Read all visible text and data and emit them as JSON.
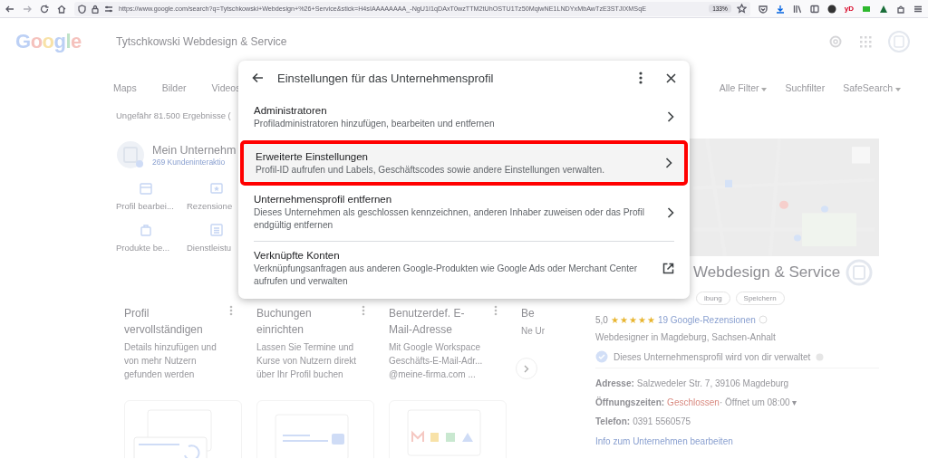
{
  "browser": {
    "url": "https://www.google.com/search?q=Tytschkowski+Webdesign+%26+Service&stick=H4sIAAAAAAAA_-NgU1I1qDAxT0wzTTM2tUhOSTU1Tz50MqiwNE1LNDYxMbAwTzE3STJIXMSqE",
    "zoom": "133%",
    "extension_label": "yD"
  },
  "page": {
    "logo": "Google",
    "query": "Tytschkowski Webdesign & Service",
    "tabs": [
      {
        "label": "Maps"
      },
      {
        "label": "Bilder"
      },
      {
        "label": "Videos"
      }
    ],
    "filters": [
      {
        "label": "Alle Filter",
        "dropdown": true
      },
      {
        "label": "Suchfilter",
        "dropdown": false
      },
      {
        "label": "SafeSearch",
        "dropdown": true
      }
    ],
    "result_stats": "Ungefähr 81.500 Ergebnisse (",
    "business": {
      "name": "Mein Unternehm",
      "interactions": "269 Kundeninteraktio",
      "actions": [
        {
          "label": "Profil bearbei...",
          "kind": "store"
        },
        {
          "label": "Rezensione",
          "kind": "review"
        },
        {
          "label": "Produkte be...",
          "kind": "bag"
        },
        {
          "label": "Dienstleistu",
          "kind": "list"
        }
      ]
    },
    "cards": [
      {
        "title": "Profil vervollständigen",
        "description": "Details hinzufügen und von mehr Nutzern gefunden werden",
        "menu": true
      },
      {
        "title": "Buchungen einrichten",
        "description": "Lassen Sie Termine und Kurse von Nutzern direkt über Ihr Profil buchen",
        "menu": true
      },
      {
        "title": "Benutzerdef. E-Mail-Adresse",
        "description": "Mit Google Workspace Geschäfts-E-Mail-Adr... @meine-firma.com ...",
        "menu": true
      },
      {
        "title": "Be",
        "description": "Ne Ur",
        "menu": false
      }
    ],
    "panel": {
      "title": "Webdesign & Service",
      "buttons": [
        "ibung",
        "Speichern"
      ],
      "rating": "5,0",
      "stars": 5,
      "reviews": "19 Google-Rezensionen",
      "category": "Webdesigner in Magdeburg, Sachsen-Anhalt",
      "managed": "Dieses Unternehmensprofil wird von dir verwaltet",
      "facts": [
        {
          "label": "Adresse:",
          "value": "Salzwedeler Str. 7, 39106 Magdeburg"
        },
        {
          "label": "Öffnungszeiten:",
          "status": "Geschlossen",
          "value": " · Öffnet um 08:00 ▾"
        },
        {
          "label": "Telefon:",
          "value": "0391 5560575"
        }
      ],
      "edit_link": "Info zum Unternehmen bearbeiten"
    }
  },
  "dialog": {
    "title": "Einstellungen für das Unternehmensprofil",
    "items": [
      {
        "title": "Administratoren",
        "description": "Profiladministratoren hinzufügen, bearbeiten und entfernen",
        "kind": "chevron",
        "highlighted": false
      },
      {
        "title": "Erweiterte Einstellungen",
        "description": "Profil-ID aufrufen und Labels, Geschäftscodes sowie andere Einstellungen verwalten.",
        "kind": "chevron",
        "highlighted": true
      },
      {
        "title": "Unternehmensprofil entfernen",
        "description": "Dieses Unternehmen als geschlossen kennzeichnen, anderen Inhaber zuweisen oder das Profil endgültig entfernen",
        "kind": "chevron",
        "highlighted": false
      },
      {
        "title": "Verknüpfte Konten",
        "description": "Verknüpfungsanfragen aus anderen Google-Produkten wie Google Ads oder Merchant Center aufrufen und verwalten",
        "kind": "external",
        "highlighted": false
      }
    ]
  }
}
